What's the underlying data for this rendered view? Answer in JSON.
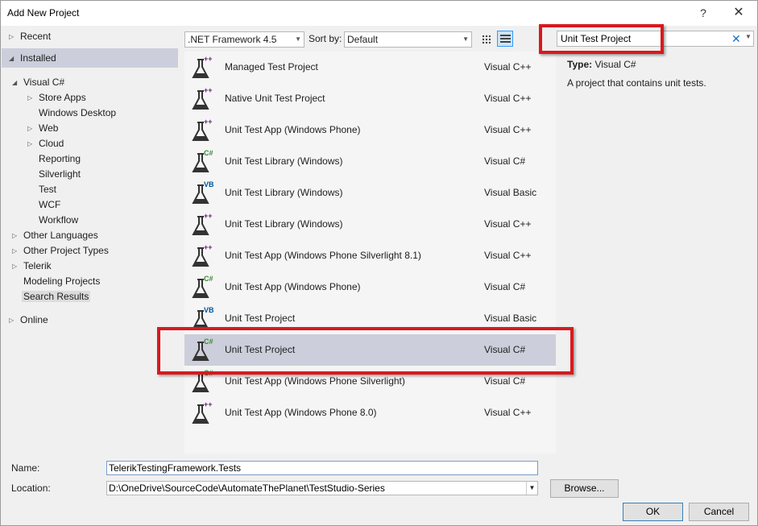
{
  "window": {
    "title": "Add New Project",
    "help": "?",
    "close": "✕"
  },
  "tree": {
    "recent": "Recent",
    "installed": "Installed",
    "visual_csharp": "Visual C#",
    "children": [
      "Store Apps",
      "Windows Desktop",
      "Web",
      "Cloud",
      "Reporting",
      "Silverlight",
      "Test",
      "WCF",
      "Workflow"
    ],
    "other_languages": "Other Languages",
    "other_project_types": "Other Project Types",
    "telerik": "Telerik",
    "modeling_projects": "Modeling Projects",
    "search_results": "Search Results",
    "online": "Online"
  },
  "toolbar": {
    "framework": ".NET Framework 4.5",
    "sort_label": "Sort by:",
    "sort_value": "Default"
  },
  "search": {
    "value": "Unit Test Project",
    "clear": "✕"
  },
  "projects": [
    {
      "name": "Managed Test Project",
      "lang": "Visual C++",
      "badge": "++",
      "badge_color": "#68217a"
    },
    {
      "name": "Native Unit Test Project",
      "lang": "Visual C++",
      "badge": "++",
      "badge_color": "#68217a"
    },
    {
      "name": "Unit Test App (Windows Phone)",
      "lang": "Visual C++",
      "badge": "++",
      "badge_color": "#68217a"
    },
    {
      "name": "Unit Test Library (Windows)",
      "lang": "Visual C#",
      "badge": "C#",
      "badge_color": "#388a34"
    },
    {
      "name": "Unit Test Library (Windows)",
      "lang": "Visual Basic",
      "badge": "VB",
      "badge_color": "#00539c"
    },
    {
      "name": "Unit Test Library (Windows)",
      "lang": "Visual C++",
      "badge": "++",
      "badge_color": "#68217a"
    },
    {
      "name": "Unit Test App (Windows Phone Silverlight 8.1)",
      "lang": "Visual C++",
      "badge": "++",
      "badge_color": "#68217a"
    },
    {
      "name": "Unit Test App (Windows Phone)",
      "lang": "Visual C#",
      "badge": "C#",
      "badge_color": "#388a34"
    },
    {
      "name": "Unit Test Project",
      "lang": "Visual Basic",
      "badge": "VB",
      "badge_color": "#00539c"
    },
    {
      "name": "Unit Test Project",
      "lang": "Visual C#",
      "badge": "C#",
      "badge_color": "#388a34"
    },
    {
      "name": "Unit Test App (Windows Phone Silverlight)",
      "lang": "Visual C#",
      "badge": "C#",
      "badge_color": "#388a34"
    },
    {
      "name": "Unit Test App (Windows Phone 8.0)",
      "lang": "Visual C++",
      "badge": "++",
      "badge_color": "#68217a"
    }
  ],
  "details": {
    "type_label": "Type:",
    "type_value": "Visual C#",
    "description": "A project that contains unit tests."
  },
  "form": {
    "name_label": "Name:",
    "name_value": "TelerikTestingFramework.Tests",
    "location_label": "Location:",
    "location_value": "D:\\OneDrive\\SourceCode\\AutomateThePlanet\\TestStudio-Series",
    "browse": "Browse...",
    "ok": "OK",
    "cancel": "Cancel"
  },
  "colors": {
    "highlight_red": "#d9191e",
    "selection": "#cccedb"
  }
}
